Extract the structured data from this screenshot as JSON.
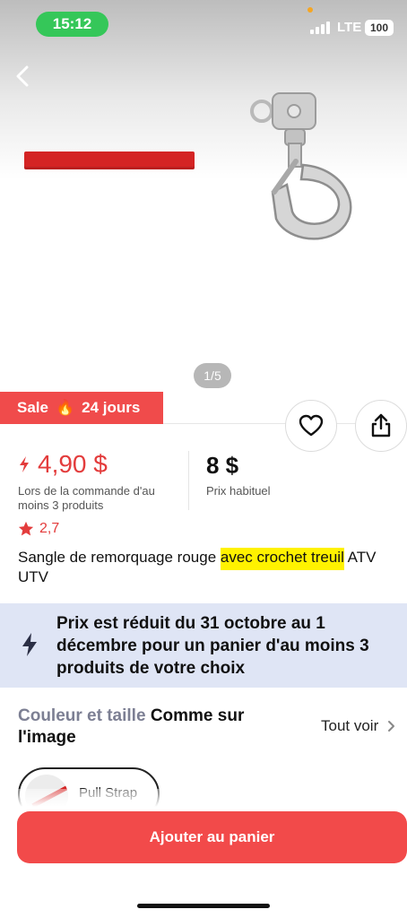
{
  "status_bar": {
    "time": "15:12",
    "network": "LTE",
    "battery": "100"
  },
  "gallery": {
    "pager": "1/5"
  },
  "sale": {
    "label": "Sale",
    "emoji": "🔥",
    "days": "24 jours"
  },
  "price": {
    "current": "4,90 $",
    "current_note": "Lors de la commande d'au moins 3 produits",
    "regular": "8 $",
    "regular_label": "Prix habituel"
  },
  "rating": {
    "value": "2,7"
  },
  "product": {
    "title_part1": "Sangle de remorquage rouge ",
    "title_highlight": "avec crochet treuil",
    "title_part2": " ATV UTV"
  },
  "promo": {
    "text": "Prix est réduit du 31 octobre au 1 décembre pour un panier d'au moins 3 produits de votre choix"
  },
  "options": {
    "label_prefix": "Couleur et taille",
    "label_value": "Comme sur l'image",
    "see_all": "Tout voir",
    "variant": "Pull Strap"
  },
  "cta": {
    "add_to_cart": "Ajouter au panier"
  },
  "colors": {
    "accent": "#f24a4a",
    "price_red": "#e33c3c",
    "promo_bg": "#dfe5f5",
    "highlight": "#fff200",
    "time_pill": "#35c759"
  }
}
